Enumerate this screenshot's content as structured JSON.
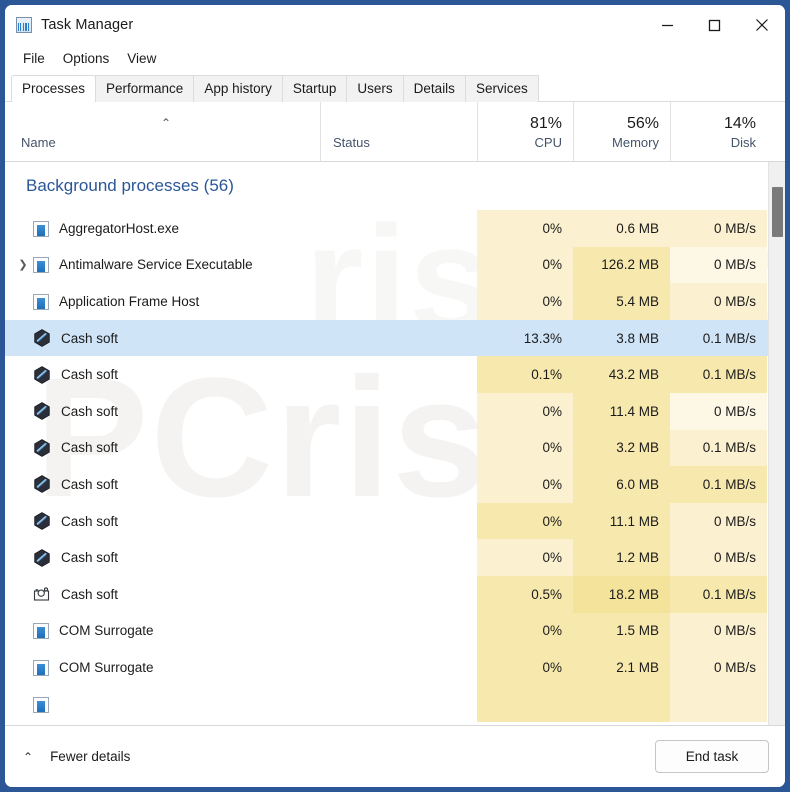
{
  "window": {
    "title": "Task Manager",
    "icon": "task-manager-chart-icon",
    "controls": {
      "minimize": "—",
      "maximize": "☐",
      "close": "✕"
    }
  },
  "menubar": {
    "items": [
      {
        "label": "File"
      },
      {
        "label": "Options"
      },
      {
        "label": "View"
      }
    ]
  },
  "tabs": [
    {
      "label": "Processes",
      "active": true
    },
    {
      "label": "Performance",
      "active": false
    },
    {
      "label": "App history",
      "active": false
    },
    {
      "label": "Startup",
      "active": false
    },
    {
      "label": "Users",
      "active": false
    },
    {
      "label": "Details",
      "active": false
    },
    {
      "label": "Services",
      "active": false
    }
  ],
  "columns": {
    "name": {
      "label": "Name",
      "pct": "",
      "sort_arrow": "⌃"
    },
    "status": {
      "label": "Status",
      "pct": ""
    },
    "cpu": {
      "label": "CPU",
      "pct": "81%"
    },
    "memory": {
      "label": "Memory",
      "pct": "56%"
    },
    "disk": {
      "label": "Disk",
      "pct": "14%"
    }
  },
  "group": {
    "label": "Background processes (56)"
  },
  "rows": [
    {
      "name": "AggregatorHost.exe",
      "icon": "window-app-icon",
      "expander": false,
      "selected": false,
      "cpu": "0%",
      "memory": "0.6 MB",
      "disk": "0 MB/s",
      "cpu_heat": 2,
      "mem_heat": 2,
      "disk_heat": 2
    },
    {
      "name": "Antimalware Service Executable",
      "icon": "window-app-icon",
      "expander": true,
      "selected": false,
      "cpu": "0%",
      "memory": "126.2 MB",
      "disk": "0 MB/s",
      "cpu_heat": 2,
      "mem_heat": 3,
      "disk_heat": 1
    },
    {
      "name": "Application Frame Host",
      "icon": "window-app-icon",
      "expander": false,
      "selected": false,
      "cpu": "0%",
      "memory": "5.4 MB",
      "disk": "0 MB/s",
      "cpu_heat": 2,
      "mem_heat": 3,
      "disk_heat": 2
    },
    {
      "name": "Cash soft",
      "icon": "hex-malware-icon",
      "expander": false,
      "selected": true,
      "cpu": "13.3%",
      "memory": "3.8 MB",
      "disk": "0.1 MB/s",
      "cpu_heat": 0,
      "mem_heat": 0,
      "disk_heat": 0
    },
    {
      "name": "Cash soft",
      "icon": "hex-malware-icon",
      "expander": false,
      "selected": false,
      "cpu": "0.1%",
      "memory": "43.2 MB",
      "disk": "0.1 MB/s",
      "cpu_heat": 3,
      "mem_heat": 3,
      "disk_heat": 3
    },
    {
      "name": "Cash soft",
      "icon": "hex-malware-icon",
      "expander": false,
      "selected": false,
      "cpu": "0%",
      "memory": "11.4 MB",
      "disk": "0 MB/s",
      "cpu_heat": 2,
      "mem_heat": 3,
      "disk_heat": 1
    },
    {
      "name": "Cash soft",
      "icon": "hex-malware-icon",
      "expander": false,
      "selected": false,
      "cpu": "0%",
      "memory": "3.2 MB",
      "disk": "0.1 MB/s",
      "cpu_heat": 2,
      "mem_heat": 3,
      "disk_heat": 2
    },
    {
      "name": "Cash soft",
      "icon": "hex-malware-icon",
      "expander": false,
      "selected": false,
      "cpu": "0%",
      "memory": "6.0 MB",
      "disk": "0.1 MB/s",
      "cpu_heat": 2,
      "mem_heat": 3,
      "disk_heat": 3
    },
    {
      "name": "Cash soft",
      "icon": "hex-malware-icon",
      "expander": false,
      "selected": false,
      "cpu": "0%",
      "memory": "11.1 MB",
      "disk": "0 MB/s",
      "cpu_heat": 3,
      "mem_heat": 3,
      "disk_heat": 2
    },
    {
      "name": "Cash soft",
      "icon": "hex-malware-icon",
      "expander": false,
      "selected": false,
      "cpu": "0%",
      "memory": "1.2 MB",
      "disk": "0 MB/s",
      "cpu_heat": 2,
      "mem_heat": 3,
      "disk_heat": 2
    },
    {
      "name": "Cash soft",
      "icon": "camera-capture-icon",
      "expander": false,
      "selected": false,
      "cpu": "0.5%",
      "memory": "18.2 MB",
      "disk": "0.1 MB/s",
      "cpu_heat": 3,
      "mem_heat": 4,
      "disk_heat": 3
    },
    {
      "name": "COM Surrogate",
      "icon": "window-app-icon",
      "expander": false,
      "selected": false,
      "cpu": "0%",
      "memory": "1.5 MB",
      "disk": "0 MB/s",
      "cpu_heat": 3,
      "mem_heat": 3,
      "disk_heat": 2
    },
    {
      "name": "COM Surrogate",
      "icon": "window-app-icon",
      "expander": false,
      "selected": false,
      "cpu": "0%",
      "memory": "2.1 MB",
      "disk": "0 MB/s",
      "cpu_heat": 3,
      "mem_heat": 3,
      "disk_heat": 2
    }
  ],
  "bottom": {
    "fewer_details_label": "Fewer details",
    "fewer_details_chevron": "⌃",
    "end_task_label": "End task"
  },
  "watermark": {
    "text1": "PCrisk",
    "text2": "risk.com"
  },
  "colors": {
    "accent": "#2b5797",
    "group_title": "#2b5797",
    "selection": "#cfe4f7",
    "heat_1": "#fdf7e6",
    "heat_2": "#fbf0cf",
    "heat_3": "#f7e9ae",
    "heat_4": "#f4e39b",
    "column_label": "#44546a"
  }
}
